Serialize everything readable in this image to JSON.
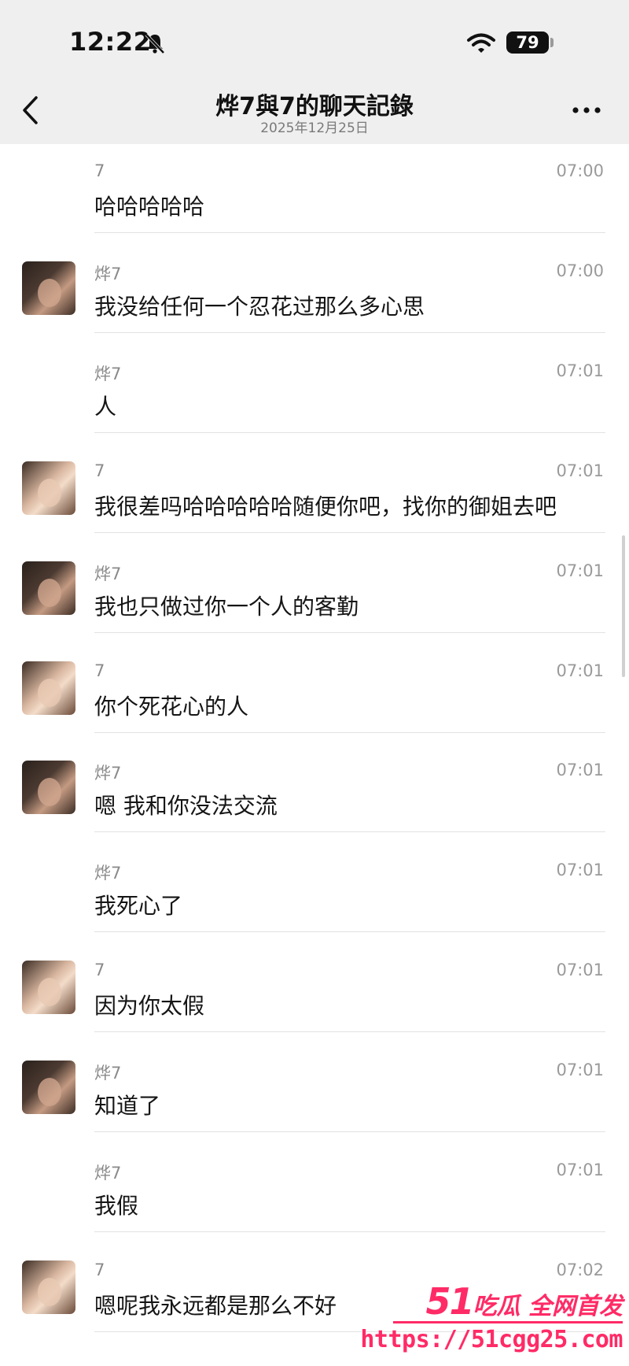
{
  "status_bar": {
    "time": "12:22",
    "battery": "79"
  },
  "header": {
    "title": "烨7與7的聊天記錄",
    "date": "2025年12月25日"
  },
  "messages": [
    {
      "name": "7",
      "time": "07:00",
      "text": "哈哈哈哈哈",
      "avatar": "none"
    },
    {
      "name": "烨7",
      "time": "07:00",
      "text": "我没给任何一个忍花过那么多心思",
      "avatar": "male"
    },
    {
      "name": "烨7",
      "time": "07:01",
      "text": "人",
      "avatar": "none"
    },
    {
      "name": "7",
      "time": "07:01",
      "text": "我很差吗哈哈哈哈哈随便你吧，找你的御姐去吧",
      "avatar": "female"
    },
    {
      "name": "烨7",
      "time": "07:01",
      "text": "我也只做过你一个人的客勤",
      "avatar": "male"
    },
    {
      "name": "7",
      "time": "07:01",
      "text": "你个死花心的人",
      "avatar": "female"
    },
    {
      "name": "烨7",
      "time": "07:01",
      "text": "嗯 我和你没法交流",
      "avatar": "male"
    },
    {
      "name": "烨7",
      "time": "07:01",
      "text": "我死心了",
      "avatar": "none"
    },
    {
      "name": "7",
      "time": "07:01",
      "text": "因为你太假",
      "avatar": "female"
    },
    {
      "name": "烨7",
      "time": "07:01",
      "text": "知道了",
      "avatar": "male"
    },
    {
      "name": "烨7",
      "time": "07:01",
      "text": "我假",
      "avatar": "none"
    },
    {
      "name": "7",
      "time": "07:02",
      "text": "嗯呢我永远都是那么不好",
      "avatar": "female"
    }
  ],
  "watermark": {
    "brand_num": "51",
    "brand_text": "吃瓜 全网首发",
    "url": "https://51cgg25.com"
  }
}
